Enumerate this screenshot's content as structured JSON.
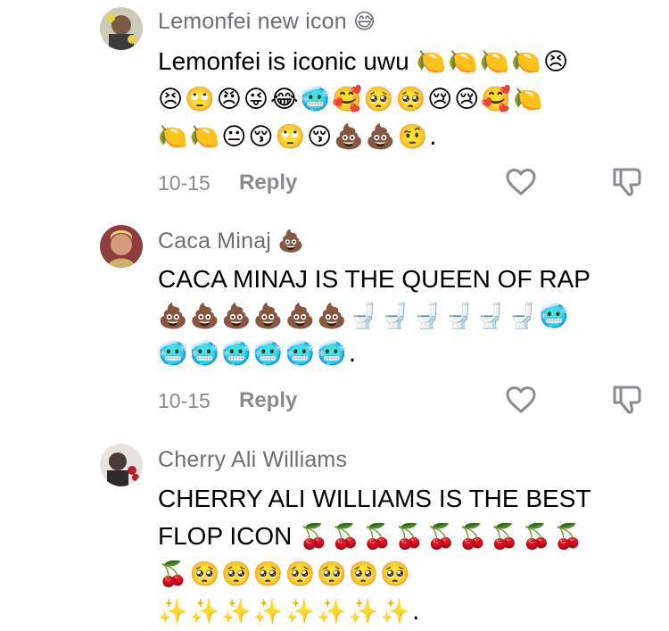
{
  "comments": [
    {
      "username": "Lemonfei new icon",
      "name_emoji": "😅",
      "text": "Lemonfei is iconic uwu",
      "emoji_line_1": "🍋🍋🍋🍋😣",
      "emoji_line_2": "😣🙄😠😜😂🥶🥰🥺🥺😢😢🥰🍋",
      "emoji_line_3": "🍋🍋😐😚🙄😚💩💩🤨.",
      "date": "10-15",
      "reply_label": "Reply"
    },
    {
      "username": "Caca Minaj",
      "name_emoji": "💩",
      "text": "CACA MINAJ IS THE QUEEN OF RAP",
      "emoji_line_1": "💩💩💩💩💩💩🚽🚽🚽🚽🚽🚽🥶",
      "emoji_line_2": "🥶🥶🥶🥶🥶🥶.",
      "date": "10-15",
      "reply_label": "Reply"
    },
    {
      "username": "Cherry Ali Williams",
      "name_emoji": "",
      "text_line_1": "CHERRY ALI WILLIAMS IS THE BEST",
      "text_line_2": "FLOP ICON",
      "emoji_after_text": "🍒🍒🍒🍒🍒🍒🍒🍒🍒",
      "emoji_line_1": "🍒🥺🥺🥺🥺🥺🥺🥺",
      "emoji_line_2": "✨✨✨✨✨✨✨✨."
    }
  ],
  "icons": {
    "like": "heart-outline-icon",
    "dislike": "thumbs-down-outline-icon"
  },
  "colors": {
    "username": "#6e6e73",
    "meta": "#8a8b91",
    "text": "#000000",
    "icon": "#8a8b91"
  }
}
